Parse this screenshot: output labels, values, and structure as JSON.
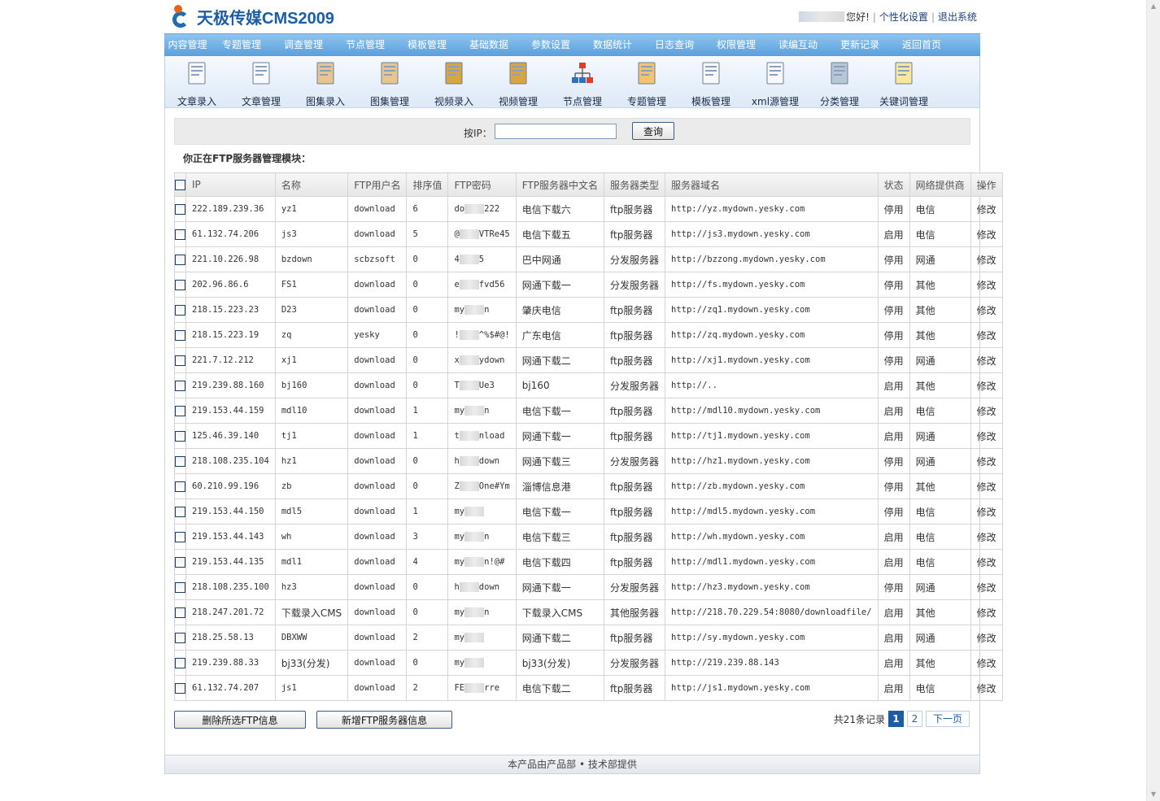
{
  "header": {
    "logo_text": "天极传媒CMS2009",
    "greeting": "您好!",
    "links": [
      "个性化设置",
      "退出系统"
    ]
  },
  "menu": [
    "内容管理",
    "专题管理",
    "调查管理",
    "节点管理",
    "模板管理",
    "基础数据",
    "参数设置",
    "数据统计",
    "日志查询",
    "权限管理",
    "读编互动",
    "更新记录",
    "返回首页"
  ],
  "toolbar": [
    {
      "label": "文章录入",
      "icon": "article-add-icon"
    },
    {
      "label": "文章管理",
      "icon": "article-manage-icon"
    },
    {
      "label": "图集录入",
      "icon": "gallery-add-icon"
    },
    {
      "label": "图集管理",
      "icon": "gallery-manage-icon"
    },
    {
      "label": "视频录入",
      "icon": "video-add-icon"
    },
    {
      "label": "视频管理",
      "icon": "video-manage-icon"
    },
    {
      "label": "节点管理",
      "icon": "node-tree-icon"
    },
    {
      "label": "专题管理",
      "icon": "topic-icon"
    },
    {
      "label": "模板管理",
      "icon": "template-icon"
    },
    {
      "label": "xml源管理",
      "icon": "xml-source-icon"
    },
    {
      "label": "分类管理",
      "icon": "category-icon"
    },
    {
      "label": "关键词管理",
      "icon": "keyword-icon"
    }
  ],
  "search": {
    "label": "按IP：",
    "value": "",
    "button": "查询"
  },
  "module_title": "你正在FTP服务器管理模块：",
  "table": {
    "headers": [
      "IP",
      "名称",
      "FTP用户名",
      "排序值",
      "FTP密码",
      "FTP服务器中文名",
      "服务器类型",
      "服务器域名",
      "状态",
      "网络提供商",
      "操作"
    ],
    "rows": [
      {
        "ip": "222.189.239.36",
        "name": "yz1",
        "user": "download",
        "sort": "6",
        "pwd_a": "do",
        "pwd_b": "222",
        "cn": "电信下载六",
        "type": "ftp服务器",
        "domain": "http://yz.mydown.yesky.com",
        "status": "停用",
        "isp": "电信",
        "op": "修改"
      },
      {
        "ip": "61.132.74.206",
        "name": "js3",
        "user": "download",
        "sort": "5",
        "pwd_a": "@",
        "pwd_b": "VTRe45",
        "cn": "电信下载五",
        "type": "ftp服务器",
        "domain": "http://js3.mydown.yesky.com",
        "status": "启用",
        "isp": "电信",
        "op": "修改"
      },
      {
        "ip": "221.10.226.98",
        "name": "bzdown",
        "user": "scbzsoft",
        "sort": "0",
        "pwd_a": "4",
        "pwd_b": "5",
        "cn": "巴中网通",
        "type": "分发服务器",
        "domain": "http://bzzong.mydown.yesky.com",
        "status": "停用",
        "isp": "网通",
        "op": "修改"
      },
      {
        "ip": "202.96.86.6",
        "name": "FS1",
        "user": "download",
        "sort": "0",
        "pwd_a": "e",
        "pwd_b": "fvd56",
        "cn": "网通下载一",
        "type": "分发服务器",
        "domain": "http://fs.mydown.yesky.com",
        "status": "停用",
        "isp": "其他",
        "op": "修改"
      },
      {
        "ip": "218.15.223.23",
        "name": "D23",
        "user": "download",
        "sort": "0",
        "pwd_a": "my",
        "pwd_b": "n",
        "cn": "肇庆电信",
        "type": "ftp服务器",
        "domain": "http://zq1.mydown.yesky.com",
        "status": "停用",
        "isp": "其他",
        "op": "修改"
      },
      {
        "ip": "218.15.223.19",
        "name": "zq",
        "user": "yesky",
        "sort": "0",
        "pwd_a": "!",
        "pwd_b": "^%$#@!",
        "cn": "广东电信",
        "type": "ftp服务器",
        "domain": "http://zq.mydown.yesky.com",
        "status": "停用",
        "isp": "其他",
        "op": "修改"
      },
      {
        "ip": "221.7.12.212",
        "name": "xj1",
        "user": "download",
        "sort": "0",
        "pwd_a": "x",
        "pwd_b": "ydown",
        "cn": "网通下载二",
        "type": "ftp服务器",
        "domain": "http://xj1.mydown.yesky.com",
        "status": "停用",
        "isp": "网通",
        "op": "修改"
      },
      {
        "ip": "219.239.88.160",
        "name": "bj160",
        "user": "download",
        "sort": "0",
        "pwd_a": "T",
        "pwd_b": "Ue3",
        "cn": "bj160",
        "type": "分发服务器",
        "domain": "http://..",
        "status": "启用",
        "isp": "其他",
        "op": "修改"
      },
      {
        "ip": "219.153.44.159",
        "name": "mdl10",
        "user": "download",
        "sort": "1",
        "pwd_a": "my",
        "pwd_b": "n",
        "cn": "电信下载一",
        "type": "ftp服务器",
        "domain": "http://mdl10.mydown.yesky.com",
        "status": "启用",
        "isp": "电信",
        "op": "修改"
      },
      {
        "ip": "125.46.39.140",
        "name": "tj1",
        "user": "download",
        "sort": "1",
        "pwd_a": "t",
        "pwd_b": "nload",
        "cn": "网通下载一",
        "type": "ftp服务器",
        "domain": "http://tj1.mydown.yesky.com",
        "status": "启用",
        "isp": "网通",
        "op": "修改"
      },
      {
        "ip": "218.108.235.104",
        "name": "hz1",
        "user": "download",
        "sort": "0",
        "pwd_a": "h",
        "pwd_b": "down",
        "cn": "网通下载三",
        "type": "分发服务器",
        "domain": "http://hz1.mydown.yesky.com",
        "status": "停用",
        "isp": "网通",
        "op": "修改"
      },
      {
        "ip": "60.210.99.196",
        "name": "zb",
        "user": "download",
        "sort": "0",
        "pwd_a": "Z",
        "pwd_b": "One#Ym",
        "cn": "淄博信息港",
        "type": "ftp服务器",
        "domain": "http://zb.mydown.yesky.com",
        "status": "停用",
        "isp": "其他",
        "op": "修改"
      },
      {
        "ip": "219.153.44.150",
        "name": "mdl5",
        "user": "download",
        "sort": "1",
        "pwd_a": "my",
        "pwd_b": "",
        "cn": "电信下载一",
        "type": "ftp服务器",
        "domain": "http://mdl5.mydown.yesky.com",
        "status": "停用",
        "isp": "电信",
        "op": "修改"
      },
      {
        "ip": "219.153.44.143",
        "name": "wh",
        "user": "download",
        "sort": "3",
        "pwd_a": "my",
        "pwd_b": "n",
        "cn": "电信下载三",
        "type": "ftp服务器",
        "domain": "http://wh.mydown.yesky.com",
        "status": "启用",
        "isp": "电信",
        "op": "修改"
      },
      {
        "ip": "219.153.44.135",
        "name": "mdl1",
        "user": "download",
        "sort": "4",
        "pwd_a": "my",
        "pwd_b": "n!@#",
        "cn": "电信下载四",
        "type": "ftp服务器",
        "domain": "http://mdl1.mydown.yesky.com",
        "status": "启用",
        "isp": "电信",
        "op": "修改"
      },
      {
        "ip": "218.108.235.100",
        "name": "hz3",
        "user": "download",
        "sort": "0",
        "pwd_a": "h",
        "pwd_b": "down",
        "cn": "网通下载一",
        "type": "分发服务器",
        "domain": "http://hz3.mydown.yesky.com",
        "status": "停用",
        "isp": "网通",
        "op": "修改"
      },
      {
        "ip": "218.247.201.72",
        "name": "下载录入CMS",
        "user": "download",
        "sort": "0",
        "pwd_a": "my",
        "pwd_b": "n",
        "cn": "下载录入CMS",
        "type": "其他服务器",
        "domain": "http://218.70.229.54:8080/downloadfile/",
        "status": "启用",
        "isp": "其他",
        "op": "修改"
      },
      {
        "ip": "218.25.58.13",
        "name": "DBXWW",
        "user": "download",
        "sort": "2",
        "pwd_a": "my",
        "pwd_b": "",
        "cn": "网通下载二",
        "type": "ftp服务器",
        "domain": "http://sy.mydown.yesky.com",
        "status": "启用",
        "isp": "网通",
        "op": "修改"
      },
      {
        "ip": "219.239.88.33",
        "name": "bj33(分发)",
        "user": "download",
        "sort": "0",
        "pwd_a": "my",
        "pwd_b": "",
        "cn": "bj33(分发)",
        "type": "分发服务器",
        "domain": "http://219.239.88.143",
        "status": "启用",
        "isp": "其他",
        "op": "修改"
      },
      {
        "ip": "61.132.74.207",
        "name": "js1",
        "user": "download",
        "sort": "2",
        "pwd_a": "FE",
        "pwd_b": "rre",
        "cn": "电信下载二",
        "type": "ftp服务器",
        "domain": "http://js1.mydown.yesky.com",
        "status": "启用",
        "isp": "电信",
        "op": "修改"
      }
    ]
  },
  "actions": {
    "delete": "删除所选FTP信息",
    "add": "新增FTP服务器信息"
  },
  "pager": {
    "total": "共21条记录",
    "pages": [
      "1",
      "2"
    ],
    "next": "下一页"
  },
  "footer": "本产品由产品部 • 技术部提供"
}
